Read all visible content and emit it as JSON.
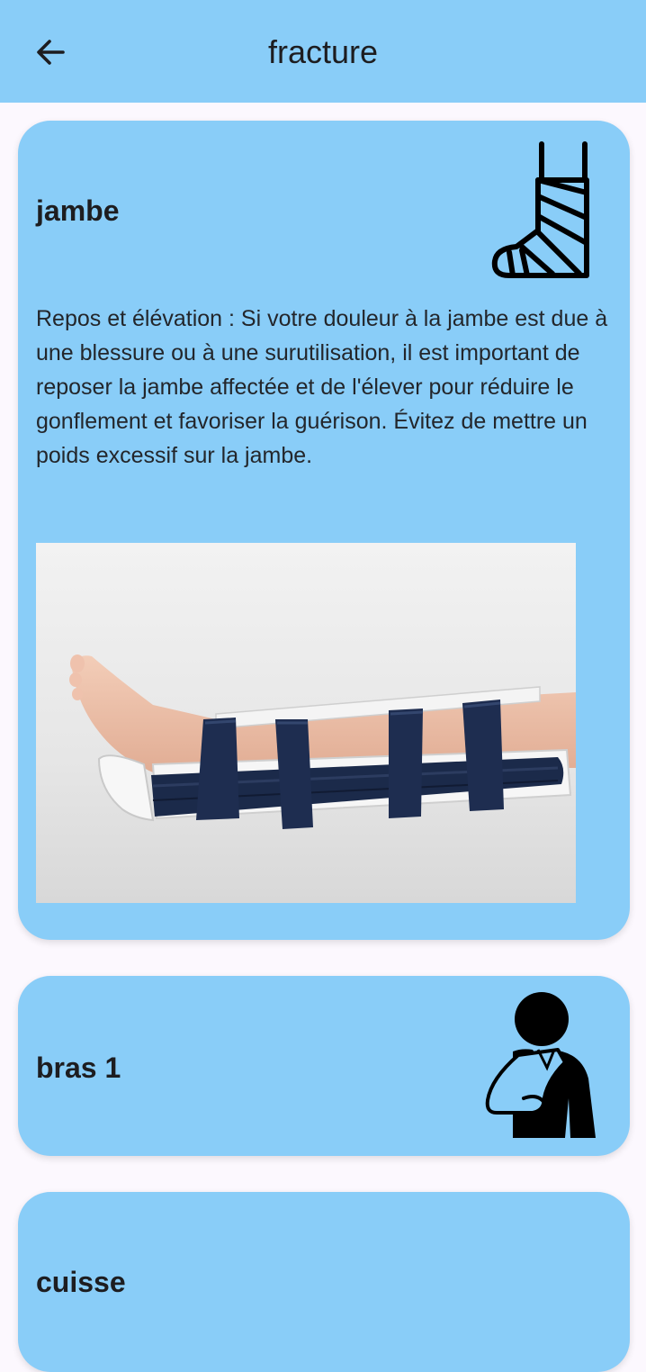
{
  "appbar": {
    "title": "fracture",
    "back_icon": "arrow-left-icon",
    "background": "#89CDF8"
  },
  "cards": [
    {
      "title": "jambe",
      "icon": "leg-cast-icon",
      "body": "Repos et élévation : Si votre douleur à la jambe est due à une blessure ou à une surutilisation, il est important de reposer la jambe affectée et de l'élever pour réduire le gonflement et favoriser la guérison. Évitez de mettre un poids excessif sur la jambe.",
      "image": "leg-splint-photo"
    },
    {
      "title": "bras 1",
      "icon": "arm-sling-icon"
    },
    {
      "title": "cuisse"
    }
  ],
  "colors": {
    "card_background": "#89CDF8",
    "page_background": "#FCF8FE",
    "splint": "#1b2a4a"
  }
}
